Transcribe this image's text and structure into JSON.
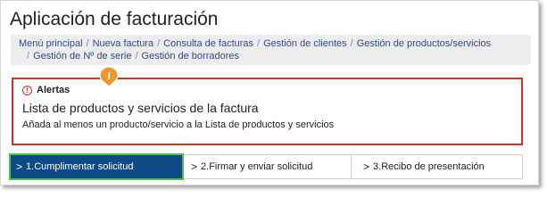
{
  "app_title": "Aplicación de facturación",
  "breadcrumb": {
    "items": [
      "Menú principal",
      "Nueva factura",
      "Consulta de facturas",
      "Gestión de clientes",
      "Gestión de productos/servicios",
      "Gestión de Nº de serie",
      "Gestión de borradores"
    ],
    "separator": "/"
  },
  "alert": {
    "icon_glyph": "!",
    "heading": "Alertas",
    "title": "Lista de productos y servicios de la factura",
    "message": "Añada al menos un producto/servicio a la Lista de productos y servicios",
    "info_glyph": "i"
  },
  "steps": [
    {
      "label": "1.Cumplimentar solicitud",
      "active": true
    },
    {
      "label": "2.Firmar y enviar solicitud",
      "active": false
    },
    {
      "label": "3.Recibo de presentación",
      "active": false
    }
  ],
  "step_chevron": ">",
  "colors": {
    "alert_border": "#d93025",
    "active_step_bg": "#0e4a86",
    "active_step_outline": "#4cc24a",
    "link": "#2a4a8c",
    "info_marker": "#f0962e"
  }
}
